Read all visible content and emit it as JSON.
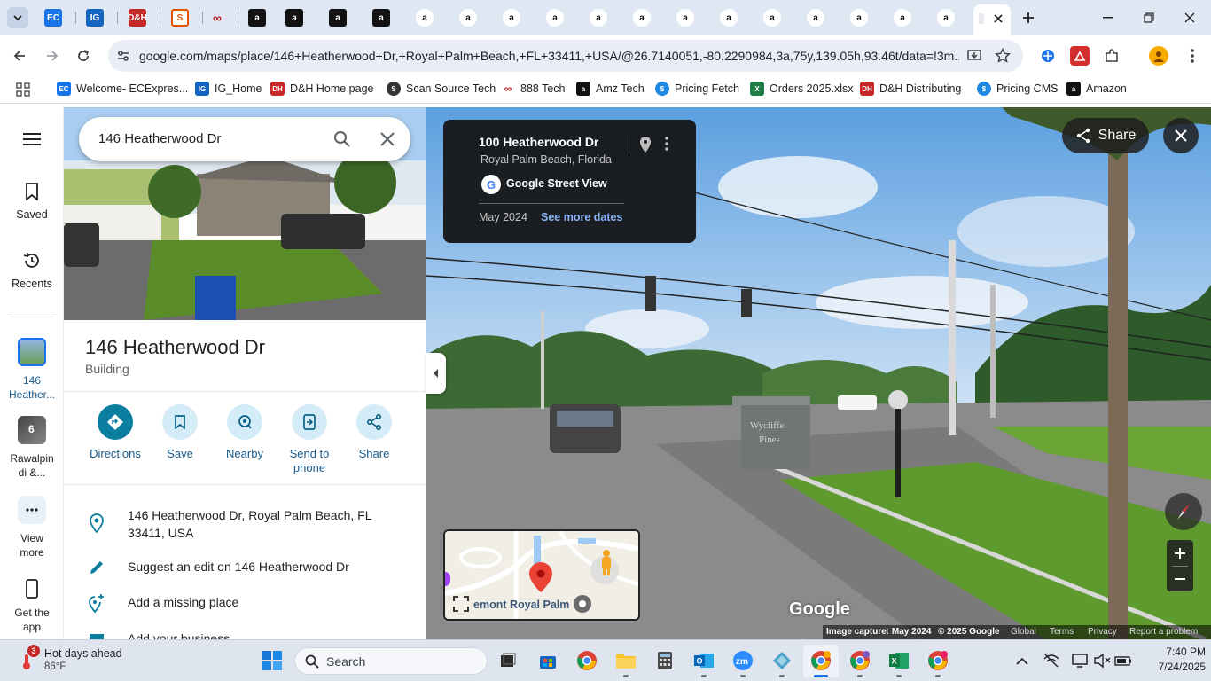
{
  "browser": {
    "tabs_count_hint": "many tabs",
    "url": "google.com/maps/place/146+Heatherwood+Dr,+Royal+Palm+Beach,+FL+33411,+USA/@26.7140051,-80.2290984,3a,75y,139.05h,93.46t/data=!3m...",
    "bookmarks": [
      {
        "label": "Welcome- ECExpres...",
        "icon": "ec-icon",
        "color": "#1a73e8"
      },
      {
        "label": "IG_Home",
        "icon": "ig-icon",
        "color": "#1565c0"
      },
      {
        "label": "D&H Home page",
        "icon": "dh-icon",
        "color": "#c62828"
      },
      {
        "label": "Scan Source Tech",
        "icon": "scansource-icon",
        "color": "#333333"
      },
      {
        "label": "888 Tech",
        "icon": "888-icon",
        "color": "#b71c1c"
      },
      {
        "label": "Amz Tech",
        "icon": "amazon-icon",
        "color": "#111111"
      },
      {
        "label": "Pricing Fetch",
        "icon": "pricing-icon",
        "color": "#1e88e5"
      },
      {
        "label": "Orders 2025.xlsx",
        "icon": "excel-icon",
        "color": "#1e7e45"
      },
      {
        "label": "D&H Distributing",
        "icon": "dh-icon",
        "color": "#c62828"
      },
      {
        "label": "Pricing CMS",
        "icon": "pricing-icon",
        "color": "#1e88e5"
      },
      {
        "label": "Amazon",
        "icon": "amazon-icon",
        "color": "#111111"
      }
    ]
  },
  "rail": {
    "saved": "Saved",
    "recents": "Recents",
    "recent1": "146 Heather...",
    "recent2": "Rawalpin di &...",
    "recent2_badge": "6",
    "view_more": "View more",
    "get_app": "Get the app"
  },
  "search": {
    "value": "146 Heatherwood Dr"
  },
  "place": {
    "title": "146 Heatherwood Dr",
    "type": "Building",
    "actions": [
      {
        "label": "Directions"
      },
      {
        "label": "Save"
      },
      {
        "label": "Nearby"
      },
      {
        "label": "Send to phone"
      },
      {
        "label": "Share"
      }
    ],
    "address": "146 Heatherwood Dr, Royal Palm Beach, FL 33411, USA",
    "suggest_edit": "Suggest an edit on 146 Heatherwood Dr",
    "add_missing": "Add a missing place",
    "add_business": "Add your business"
  },
  "streetview": {
    "card_title": "100 Heatherwood Dr",
    "card_subtitle": "Royal Palm Beach, Florida",
    "provider": "Google Street View",
    "date": "May 2024",
    "more_dates": "See more dates",
    "share": "Share",
    "minimap_label": "emont Royal Palm",
    "google_logo": "Google",
    "footer": {
      "capture": "Image capture: May 2024",
      "copyright": "© 2025 Google",
      "global": "Global",
      "terms": "Terms",
      "privacy": "Privacy",
      "report": "Report a problem"
    },
    "sign_text": "Wycliffe Pines"
  },
  "taskbar": {
    "weather_title": "Hot days ahead",
    "weather_temp": "86°F",
    "weather_badge": "3",
    "search_placeholder": "Search",
    "time": "7:40 PM",
    "date": "7/24/2025"
  },
  "colors": {
    "maps_teal": "#0b7d9f",
    "action_bg": "#d3ecf7",
    "chrome_tab_bg": "#dfe7f3"
  }
}
